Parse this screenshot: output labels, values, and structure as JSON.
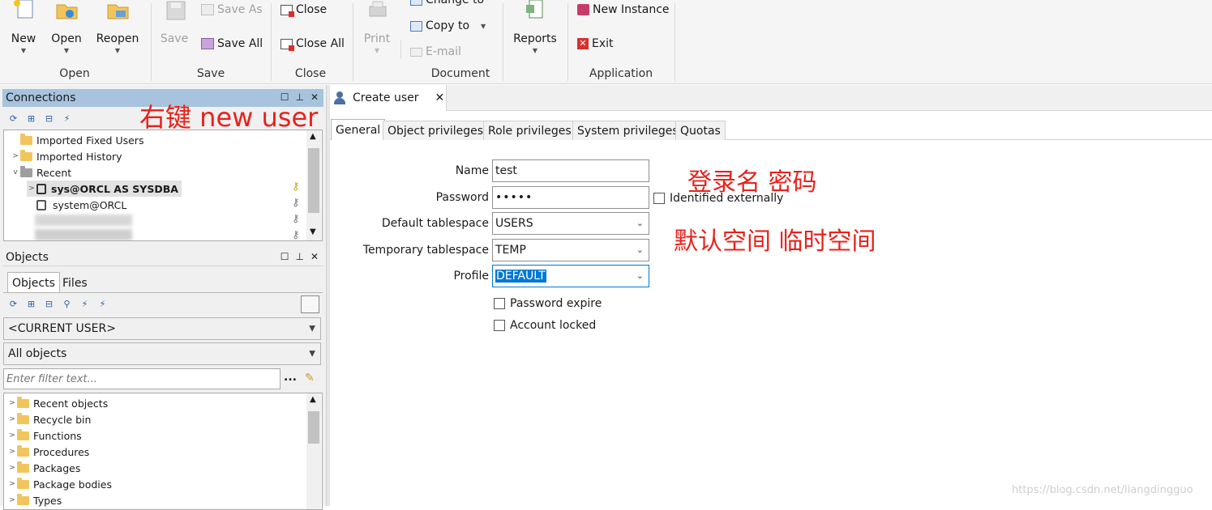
{
  "ribbon": {
    "new": "New",
    "open": "Open",
    "reopen": "Reopen",
    "save": "Save",
    "save_as": "Save As",
    "save_all": "Save All",
    "close": "Close",
    "close_all": "Close All",
    "print": "Print",
    "change_to": "Change to",
    "copy_to": "Copy to",
    "email": "E-mail",
    "reports": "Reports",
    "new_instance": "New Instance",
    "exit": "Exit",
    "groups": {
      "open": "Open",
      "save": "Save",
      "close": "Close",
      "document": "Document",
      "application": "Application"
    }
  },
  "connections": {
    "title": "Connections",
    "items": [
      {
        "label": "Imported Fixed Users"
      },
      {
        "label": "Imported History"
      },
      {
        "label": "Recent"
      },
      {
        "label": "sys@ORCL AS SYSDBA"
      },
      {
        "label": "system@ORCL"
      }
    ]
  },
  "objects": {
    "title": "Objects",
    "tabs": [
      "Objects",
      "Files"
    ],
    "user_select": "<CURRENT USER>",
    "type_select": "All objects",
    "filter_placeholder": "Enter filter text...",
    "filter_more": "...",
    "items": [
      {
        "label": "Recent objects"
      },
      {
        "label": "Recycle bin"
      },
      {
        "label": "Functions"
      },
      {
        "label": "Procedures"
      },
      {
        "label": "Packages"
      },
      {
        "label": "Package bodies"
      },
      {
        "label": "Types"
      }
    ]
  },
  "editor": {
    "tab_title": "Create user",
    "subtabs": [
      "General",
      "Object privileges",
      "Role privileges",
      "System privileges",
      "Quotas"
    ],
    "form": {
      "name_label": "Name",
      "name_value": "test",
      "password_label": "Password",
      "password_value": "•••••",
      "identified_externally": "Identified externally",
      "default_ts_label": "Default tablespace",
      "default_ts_value": "USERS",
      "temp_ts_label": "Temporary tablespace",
      "temp_ts_value": "TEMP",
      "profile_label": "Profile",
      "profile_value": "DEFAULT",
      "password_expire": "Password expire",
      "account_locked": "Account locked"
    }
  },
  "annotations": {
    "right_click": "右键 new  user",
    "login_password": "登录名 密码",
    "tablespaces": "默认空间 临时空间"
  },
  "watermark": "https://blog.csdn.net/liangdingguo",
  "colors": {
    "panel_header_active": "#a8c3de",
    "selection": "#0078d7",
    "annotation": "#e8221b"
  }
}
